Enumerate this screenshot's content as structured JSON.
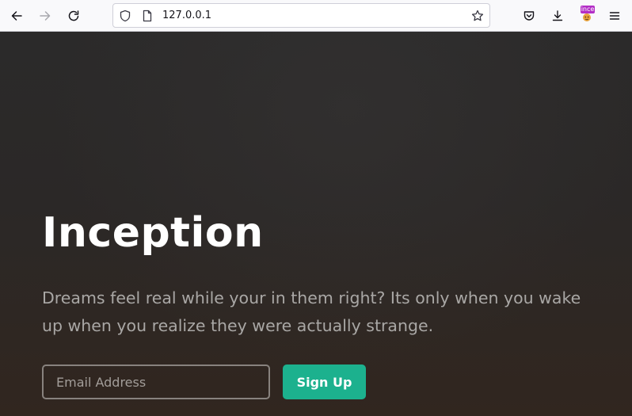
{
  "browser": {
    "url": "127.0.0.1",
    "extension_badge": "ince"
  },
  "icons": {
    "back": "arrow-left-icon",
    "forward": "arrow-right-icon",
    "reload": "reload-icon",
    "site_info": "shield-icon",
    "page": "page-icon",
    "bookmark": "star-icon",
    "pocket": "pocket-icon",
    "downloads": "download-icon",
    "extension": "extension-icon",
    "menu": "hamburger-menu-icon"
  },
  "hero": {
    "title": "Inception",
    "text": "Dreams feel real while your in them right? Its only when you wake up when you realize they were actually strange.",
    "email_placeholder": "Email Address",
    "signup_label": "Sign Up"
  },
  "colors": {
    "accent": "#1cb18e",
    "badge": "#b32ec6"
  }
}
